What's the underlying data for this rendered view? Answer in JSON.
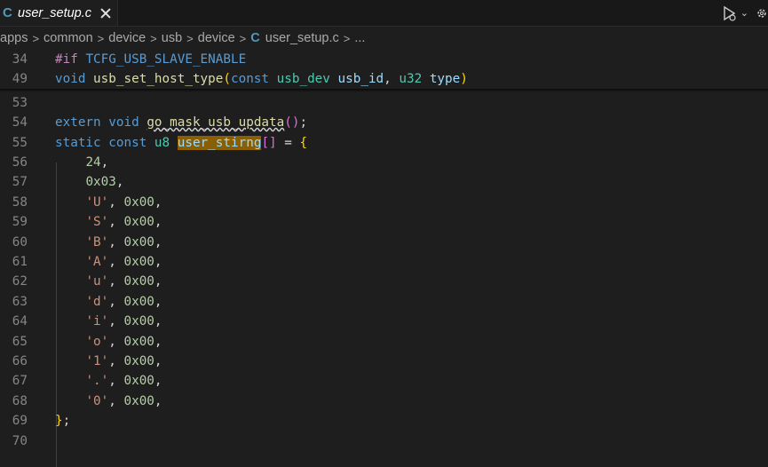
{
  "tab": {
    "icon": "C",
    "label": "user_setup.c"
  },
  "breadcrumb": {
    "segments": [
      "apps",
      "common",
      "device",
      "usb",
      "device"
    ],
    "file_icon": "C",
    "file": "user_setup.c",
    "more": "..."
  },
  "colors": {
    "accent": "#519aba",
    "highlight": "#8a5f04"
  },
  "sticky_lines": [
    {
      "num": "34",
      "parts": [
        [
          "#if",
          "kw-pre"
        ],
        [
          " ",
          ""
        ],
        [
          "TCFG_USB_SLAVE_ENABLE",
          "kw"
        ]
      ]
    },
    {
      "num": "49",
      "parts": [
        [
          "void",
          "kw"
        ],
        [
          " ",
          ""
        ],
        [
          "usb_set_host_type",
          "fn"
        ],
        [
          "(",
          "br"
        ],
        [
          "const",
          "kw"
        ],
        [
          " ",
          ""
        ],
        [
          "usb_dev",
          "ty"
        ],
        [
          " ",
          ""
        ],
        [
          "usb_id",
          "var"
        ],
        [
          ", ",
          ""
        ],
        [
          "u32",
          "ty"
        ],
        [
          " ",
          ""
        ],
        [
          "type",
          "var"
        ],
        [
          ")",
          "br"
        ]
      ]
    }
  ],
  "lines": [
    {
      "num": "53",
      "parts": []
    },
    {
      "num": "54",
      "parts": [
        [
          "extern",
          "kw"
        ],
        [
          " ",
          ""
        ],
        [
          "void",
          "kw"
        ],
        [
          " ",
          ""
        ],
        [
          "go_mask_usb_updata",
          "fn squig"
        ],
        [
          "()",
          "br2"
        ],
        [
          ";",
          ""
        ]
      ]
    },
    {
      "num": "55",
      "parts": [
        [
          "static",
          "kw"
        ],
        [
          " ",
          ""
        ],
        [
          "const",
          "kw"
        ],
        [
          " ",
          ""
        ],
        [
          "u8",
          "ty"
        ],
        [
          " ",
          ""
        ],
        [
          "user_stirng",
          "hl"
        ],
        [
          "[]",
          "br2"
        ],
        [
          " = ",
          ""
        ],
        [
          "{",
          "br"
        ]
      ]
    },
    {
      "num": "56",
      "parts": [
        [
          "    ",
          ""
        ],
        [
          "24",
          "num"
        ],
        [
          ",",
          ""
        ]
      ]
    },
    {
      "num": "57",
      "parts": [
        [
          "    ",
          ""
        ],
        [
          "0x03",
          "num"
        ],
        [
          ",",
          ""
        ]
      ]
    },
    {
      "num": "58",
      "parts": [
        [
          "    ",
          ""
        ],
        [
          "'U'",
          "str"
        ],
        [
          ", ",
          ""
        ],
        [
          "0x00",
          "num"
        ],
        [
          ",",
          ""
        ]
      ]
    },
    {
      "num": "59",
      "parts": [
        [
          "    ",
          ""
        ],
        [
          "'S'",
          "str"
        ],
        [
          ", ",
          ""
        ],
        [
          "0x00",
          "num"
        ],
        [
          ",",
          ""
        ]
      ]
    },
    {
      "num": "60",
      "parts": [
        [
          "    ",
          ""
        ],
        [
          "'B'",
          "str"
        ],
        [
          ", ",
          ""
        ],
        [
          "0x00",
          "num"
        ],
        [
          ",",
          ""
        ]
      ]
    },
    {
      "num": "61",
      "parts": [
        [
          "    ",
          ""
        ],
        [
          "'A'",
          "str"
        ],
        [
          ", ",
          ""
        ],
        [
          "0x00",
          "num"
        ],
        [
          ",",
          ""
        ]
      ]
    },
    {
      "num": "62",
      "parts": [
        [
          "    ",
          ""
        ],
        [
          "'u'",
          "str"
        ],
        [
          ", ",
          ""
        ],
        [
          "0x00",
          "num"
        ],
        [
          ",",
          ""
        ]
      ]
    },
    {
      "num": "63",
      "parts": [
        [
          "    ",
          ""
        ],
        [
          "'d'",
          "str"
        ],
        [
          ", ",
          ""
        ],
        [
          "0x00",
          "num"
        ],
        [
          ",",
          ""
        ]
      ]
    },
    {
      "num": "64",
      "parts": [
        [
          "    ",
          ""
        ],
        [
          "'i'",
          "str"
        ],
        [
          ", ",
          ""
        ],
        [
          "0x00",
          "num"
        ],
        [
          ",",
          ""
        ]
      ]
    },
    {
      "num": "65",
      "parts": [
        [
          "    ",
          ""
        ],
        [
          "'o'",
          "str"
        ],
        [
          ", ",
          ""
        ],
        [
          "0x00",
          "num"
        ],
        [
          ",",
          ""
        ]
      ]
    },
    {
      "num": "66",
      "parts": [
        [
          "    ",
          ""
        ],
        [
          "'1'",
          "str"
        ],
        [
          ", ",
          ""
        ],
        [
          "0x00",
          "num"
        ],
        [
          ",",
          ""
        ]
      ]
    },
    {
      "num": "67",
      "parts": [
        [
          "    ",
          ""
        ],
        [
          "'.'",
          "str"
        ],
        [
          ", ",
          ""
        ],
        [
          "0x00",
          "num"
        ],
        [
          ",",
          ""
        ]
      ]
    },
    {
      "num": "68",
      "parts": [
        [
          "    ",
          ""
        ],
        [
          "'0'",
          "str"
        ],
        [
          ", ",
          ""
        ],
        [
          "0x00",
          "num"
        ],
        [
          ",",
          ""
        ]
      ]
    },
    {
      "num": "69",
      "parts": [
        [
          "}",
          "br"
        ],
        [
          ";",
          ""
        ]
      ]
    },
    {
      "num": "70",
      "parts": []
    }
  ]
}
